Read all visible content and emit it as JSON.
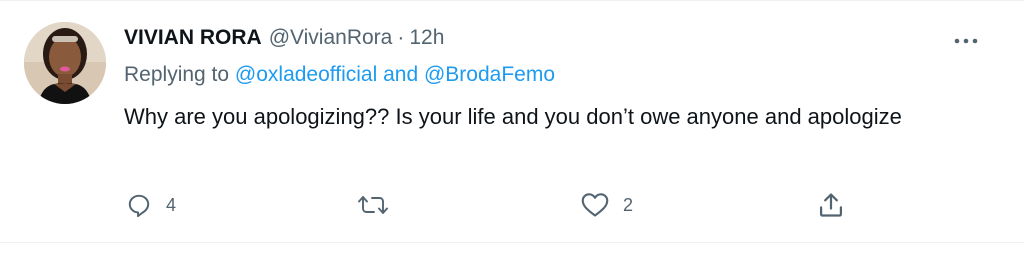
{
  "tweet": {
    "display_name": "VIVIAN RORA",
    "handle": "@VivianRora",
    "separator": "·",
    "time": "12h",
    "replying_prefix": "Replying to ",
    "replying_user1": "@oxladeofficial",
    "replying_and": " and ",
    "replying_user2": "@BrodaFemo",
    "text": "Why are you apologizing??  Is your life and you don’t owe anyone and apologize"
  },
  "actions": {
    "reply_count": "4",
    "retweet_count": "",
    "like_count": "2"
  },
  "icons": {
    "avatar": "profile-photo",
    "more": "more-horizontal-icon",
    "reply": "reply-icon",
    "retweet": "retweet-icon",
    "like": "heart-icon",
    "share": "share-icon"
  },
  "colors": {
    "link": "#1d9bf0",
    "muted": "#536471",
    "text": "#0f1419",
    "divider": "#eff3f4"
  }
}
